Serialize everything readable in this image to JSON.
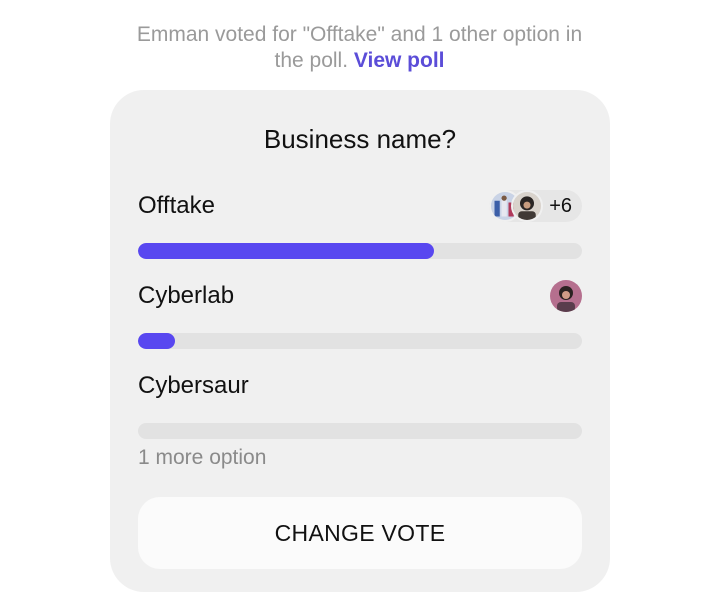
{
  "notice": {
    "line1": "Emman voted for \"Offtake\" and 1 other option in",
    "line2_prefix": "the poll. ",
    "link": "View poll"
  },
  "poll": {
    "title": "Business name?",
    "options": [
      {
        "label": "Offtake",
        "fraction": 0.667,
        "voters_extra": "+6",
        "avatar_icons": [
          "user-avatar-icon",
          "user-avatar-icon"
        ]
      },
      {
        "label": "Cyberlab",
        "fraction": 0.083,
        "avatar_icons": [
          "user-avatar-icon"
        ]
      },
      {
        "label": "Cybersaur",
        "fraction": 0.0
      }
    ],
    "more_options": "1 more option",
    "change_vote": "CHANGE VOTE"
  },
  "colors": {
    "accent": "#5847f0",
    "link": "#5b4dd8",
    "card_bg": "#f0f0f0",
    "track": "#e2e2e2"
  }
}
